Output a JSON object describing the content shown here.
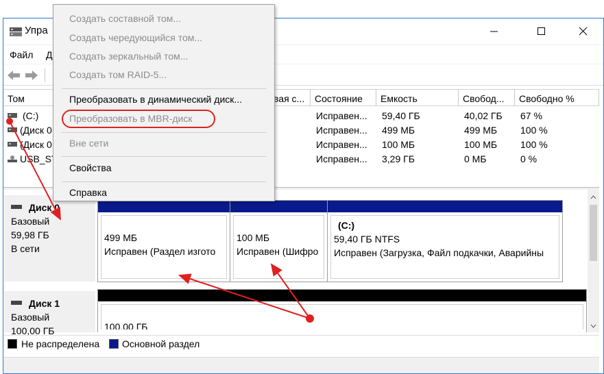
{
  "window": {
    "title": "Упра"
  },
  "menubar": {
    "items": [
      "Файл",
      "Д"
    ]
  },
  "table": {
    "columns": [
      "Том",
      "вая с...",
      "Состояние",
      "Емкость",
      "Свобод...",
      "Свободно %"
    ],
    "rows": [
      {
        "name": "(C:)",
        "state": "Исправен...",
        "capacity": "59,40 ГБ",
        "free": "40,02 ГБ",
        "free_pct": "67 %"
      },
      {
        "name": "(Диск 0",
        "state": "Исправен...",
        "capacity": "499 МБ",
        "free": "499 МБ",
        "free_pct": "100 %"
      },
      {
        "name": "(Диск 0",
        "state": "Исправен...",
        "capacity": "100 МБ",
        "free": "100 МБ",
        "free_pct": "100 %"
      },
      {
        "name": "USB_ST",
        "state": "Исправен...",
        "capacity": "3,29 ГБ",
        "free": "0 МБ",
        "free_pct": "0 %"
      }
    ]
  },
  "disks": [
    {
      "name": "Диск 0",
      "type": "Базовый",
      "size": "59,98 ГБ",
      "status": "В сети",
      "partitions": [
        {
          "title": "",
          "size": "499 МБ",
          "state": "Исправен (Раздел изгото"
        },
        {
          "title": "",
          "size": "100 МБ",
          "state": "Исправен (Шифро"
        },
        {
          "title": "(C:)",
          "size": "59,40 ГБ NTFS",
          "state": "Исправен (Загрузка, Файл подкачки, Аварийны"
        }
      ]
    },
    {
      "name": "Диск 1",
      "type": "Базовый",
      "size": "100,00 ГБ",
      "partitions": [
        {
          "size": "100,00 ГБ"
        }
      ]
    }
  ],
  "legend": {
    "unallocated": "Не распределена",
    "primary": "Основной раздел"
  },
  "context_menu": {
    "items": [
      "Создать составной том...",
      "Создать чередующийся том...",
      "Создать зеркальный том...",
      "Создать том RAID-5...",
      "Преобразовать в динамический диск...",
      "Преобразовать в MBR-диск",
      "Вне сети",
      "Свойства",
      "Справка"
    ]
  },
  "colors": {
    "primary_partition": "#0a1a8c",
    "unallocated": "#000000",
    "annotation": "#e02020"
  }
}
